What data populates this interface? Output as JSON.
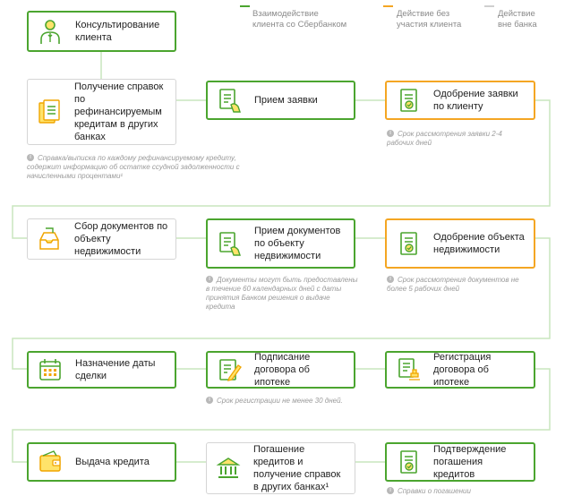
{
  "colors": {
    "green": "#4ba52f",
    "orange": "#f4a623",
    "gray": "#d5d5d5"
  },
  "legend": [
    {
      "text": "Взаимодействие\nклиента со Сбербанком",
      "color": "#4ba52f"
    },
    {
      "text": "Действие без\nучастия клиента",
      "color": "#f4a623"
    },
    {
      "text": "Действие\nвне банка",
      "color": "#cfcfcf"
    }
  ],
  "steps": [
    {
      "label": "Консультирование клиента",
      "type": "green",
      "icon": "person-icon"
    },
    {
      "label": "Получение справок по рефинансируемым кредитам в других банках",
      "type": "gray",
      "icon": "documents-icon"
    },
    {
      "label": "Прием заявки",
      "type": "green",
      "icon": "document-hand-icon"
    },
    {
      "label": "Одобрение заявки по клиенту",
      "type": "orange",
      "icon": "document-check-icon"
    },
    {
      "label": "Сбор документов по объекту недвижимости",
      "type": "gray",
      "icon": "inbox-icon"
    },
    {
      "label": "Прием документов по объекту недвижимости",
      "type": "green",
      "icon": "document-hand-icon"
    },
    {
      "label": "Одобрение объекта недвижимости",
      "type": "orange",
      "icon": "document-check-icon"
    },
    {
      "label": "Назначение даты сделки",
      "type": "green",
      "icon": "calendar-icon"
    },
    {
      "label": "Подписание договора об ипотеке",
      "type": "green",
      "icon": "document-pen-icon"
    },
    {
      "label": "Регистрация договора об ипотеке",
      "type": "green",
      "icon": "document-stamp-icon"
    },
    {
      "label": "Выдача кредита",
      "type": "green",
      "icon": "wallet-icon"
    },
    {
      "label": "Погашение кредитов и получение справок в других банках¹",
      "type": "gray",
      "icon": "bank-icon"
    },
    {
      "label": "Подтверждение погашения кредитов",
      "type": "green",
      "icon": "document-check-icon"
    }
  ],
  "notes": [
    "Справка/выписка по каждому рефинансируемому кредиту, содержит информацию об остатке ссудной задолженности с начисленными процентами¹",
    "Срок рассмотрения заявки 2-4 рабочих дней",
    "Документы могут быть предоставлены в течение 60 календарных дней с даты принятия Банком решения о выдаче кредита",
    "Срок рассмотрения документов не более 5 рабочих дней",
    "Срок регистрации не менее 30 дней.",
    "Справки о погашении"
  ]
}
